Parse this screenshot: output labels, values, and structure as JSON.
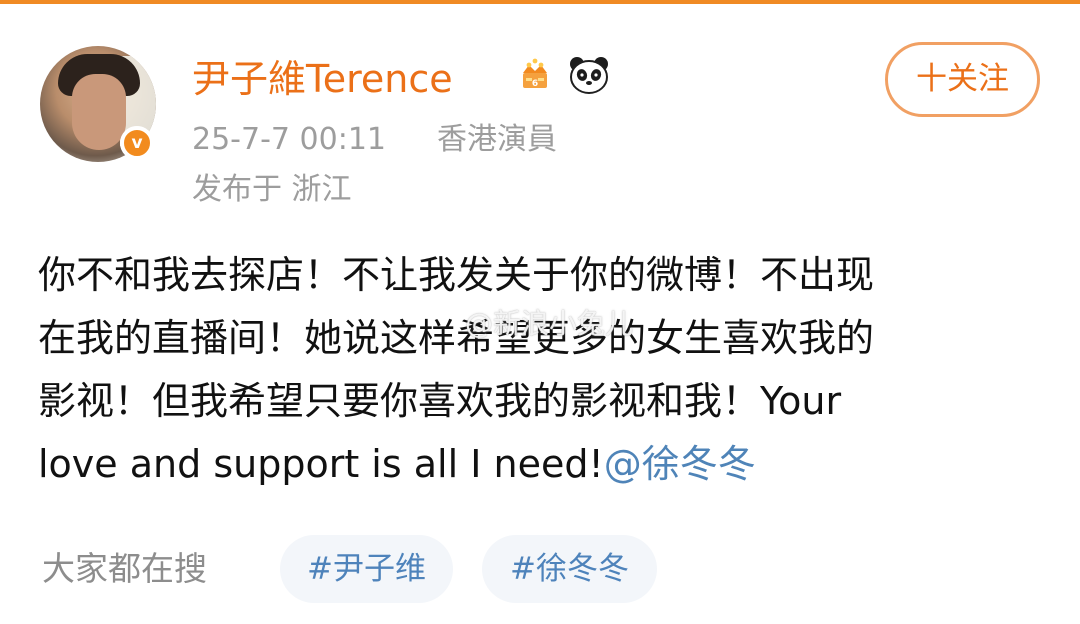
{
  "colors": {
    "accent": "#eb7018",
    "meta": "#9d9d9d",
    "link": "#4f84b8",
    "chip_background": "#f3f6fa"
  },
  "profile": {
    "username": "尹子維Terence",
    "avatar_icon": "avatar-photo",
    "verified_icon": "verified-v-icon",
    "verified_text": "v",
    "crown_icon": "crown-icon",
    "panda_icon": "panda-icon"
  },
  "actions": {
    "follow_label": "十关注"
  },
  "meta": {
    "time": "25-7-7 00:11",
    "title": "香港演員",
    "location": "发布于 浙江"
  },
  "post": {
    "lines": [
      "你不和我去探店！不让我发关于你的微博！不出现",
      "在我的直播间！她说这样希望更多的女生喜欢我的",
      "影视！但我希望只要你喜欢我的影视和我！Your",
      "love and support is all I need!"
    ],
    "mention": "@徐冬冬"
  },
  "watermark": {
    "text": "@新浪小兔儿"
  },
  "hot_search": {
    "label": "大家都在搜",
    "topics": [
      "#尹子维",
      "#徐冬冬"
    ]
  }
}
